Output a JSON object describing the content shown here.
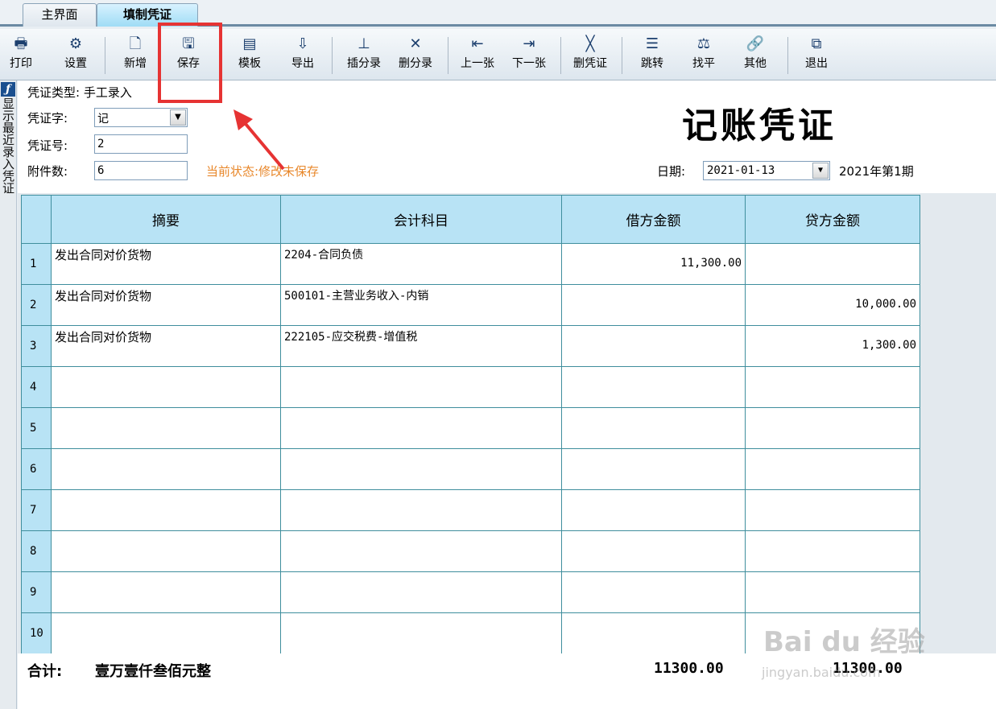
{
  "tabs": [
    {
      "label": "主界面"
    },
    {
      "label": "填制凭证"
    }
  ],
  "toolbar": {
    "print": {
      "label": "打印",
      "icon": "printer-icon"
    },
    "settings": {
      "label": "设置",
      "icon": "settings-icon"
    },
    "add": {
      "label": "新增",
      "icon": "new-doc-icon"
    },
    "save": {
      "label": "保存",
      "icon": "save-icon"
    },
    "template": {
      "label": "模板",
      "icon": "template-icon"
    },
    "export": {
      "label": "导出",
      "icon": "export-icon"
    },
    "insert_entry": {
      "label": "插分录",
      "icon": "insert-row-icon"
    },
    "delete_entry": {
      "label": "删分录",
      "icon": "delete-row-icon"
    },
    "prev": {
      "label": "上一张",
      "icon": "prev-icon"
    },
    "next": {
      "label": "下一张",
      "icon": "next-icon"
    },
    "delete_voucher": {
      "label": "删凭证",
      "icon": "delete-icon"
    },
    "jump": {
      "label": "跳转",
      "icon": "jump-icon"
    },
    "balance": {
      "label": "找平",
      "icon": "balance-icon"
    },
    "other": {
      "label": "其他",
      "icon": "link-icon"
    },
    "exit": {
      "label": "退出",
      "icon": "exit-icon"
    }
  },
  "sidebar": {
    "label": "显示最近录入凭证"
  },
  "form": {
    "voucher_type_label": "凭证类型:",
    "voucher_type_value": "手工录入",
    "voucher_word_label": "凭证字:",
    "voucher_word_value": "记",
    "voucher_no_label": "凭证号:",
    "voucher_no_value": "2",
    "attachments_label": "附件数:",
    "attachments_value": "6",
    "status": "当前状态:修改未保存",
    "title": "记账凭证",
    "date_label": "日期:",
    "date_value": "2021-01-13",
    "period": "2021年第1期"
  },
  "grid": {
    "headers": [
      "摘要",
      "会计科目",
      "借方金额",
      "贷方金额"
    ],
    "rows": [
      {
        "no": "1",
        "summary": "发出合同对价货物",
        "account": "2204-合同负债",
        "debit": "11,300.00",
        "credit": ""
      },
      {
        "no": "2",
        "summary": "发出合同对价货物",
        "account": "500101-主营业务收入-内销",
        "debit": "",
        "credit": "10,000.00"
      },
      {
        "no": "3",
        "summary": "发出合同对价货物",
        "account": "222105-应交税费-增值税",
        "debit": "",
        "credit": "1,300.00"
      },
      {
        "no": "4",
        "summary": "",
        "account": "",
        "debit": "",
        "credit": ""
      },
      {
        "no": "5",
        "summary": "",
        "account": "",
        "debit": "",
        "credit": ""
      },
      {
        "no": "6",
        "summary": "",
        "account": "",
        "debit": "",
        "credit": ""
      },
      {
        "no": "7",
        "summary": "",
        "account": "",
        "debit": "",
        "credit": ""
      },
      {
        "no": "8",
        "summary": "",
        "account": "",
        "debit": "",
        "credit": ""
      },
      {
        "no": "9",
        "summary": "",
        "account": "",
        "debit": "",
        "credit": ""
      },
      {
        "no": "10",
        "summary": "",
        "account": "",
        "debit": "",
        "credit": ""
      }
    ]
  },
  "totals": {
    "label": "合计:",
    "words": "壹万壹仟叁佰元整",
    "debit": "11300.00",
    "credit": "11300.00"
  },
  "watermark": {
    "main": "Bai du 经验",
    "sub": "jingyan.baidu.com"
  },
  "colors": {
    "highlight": "#e63333",
    "status": "#e8872a",
    "header_bg": "#b8e3f5"
  }
}
